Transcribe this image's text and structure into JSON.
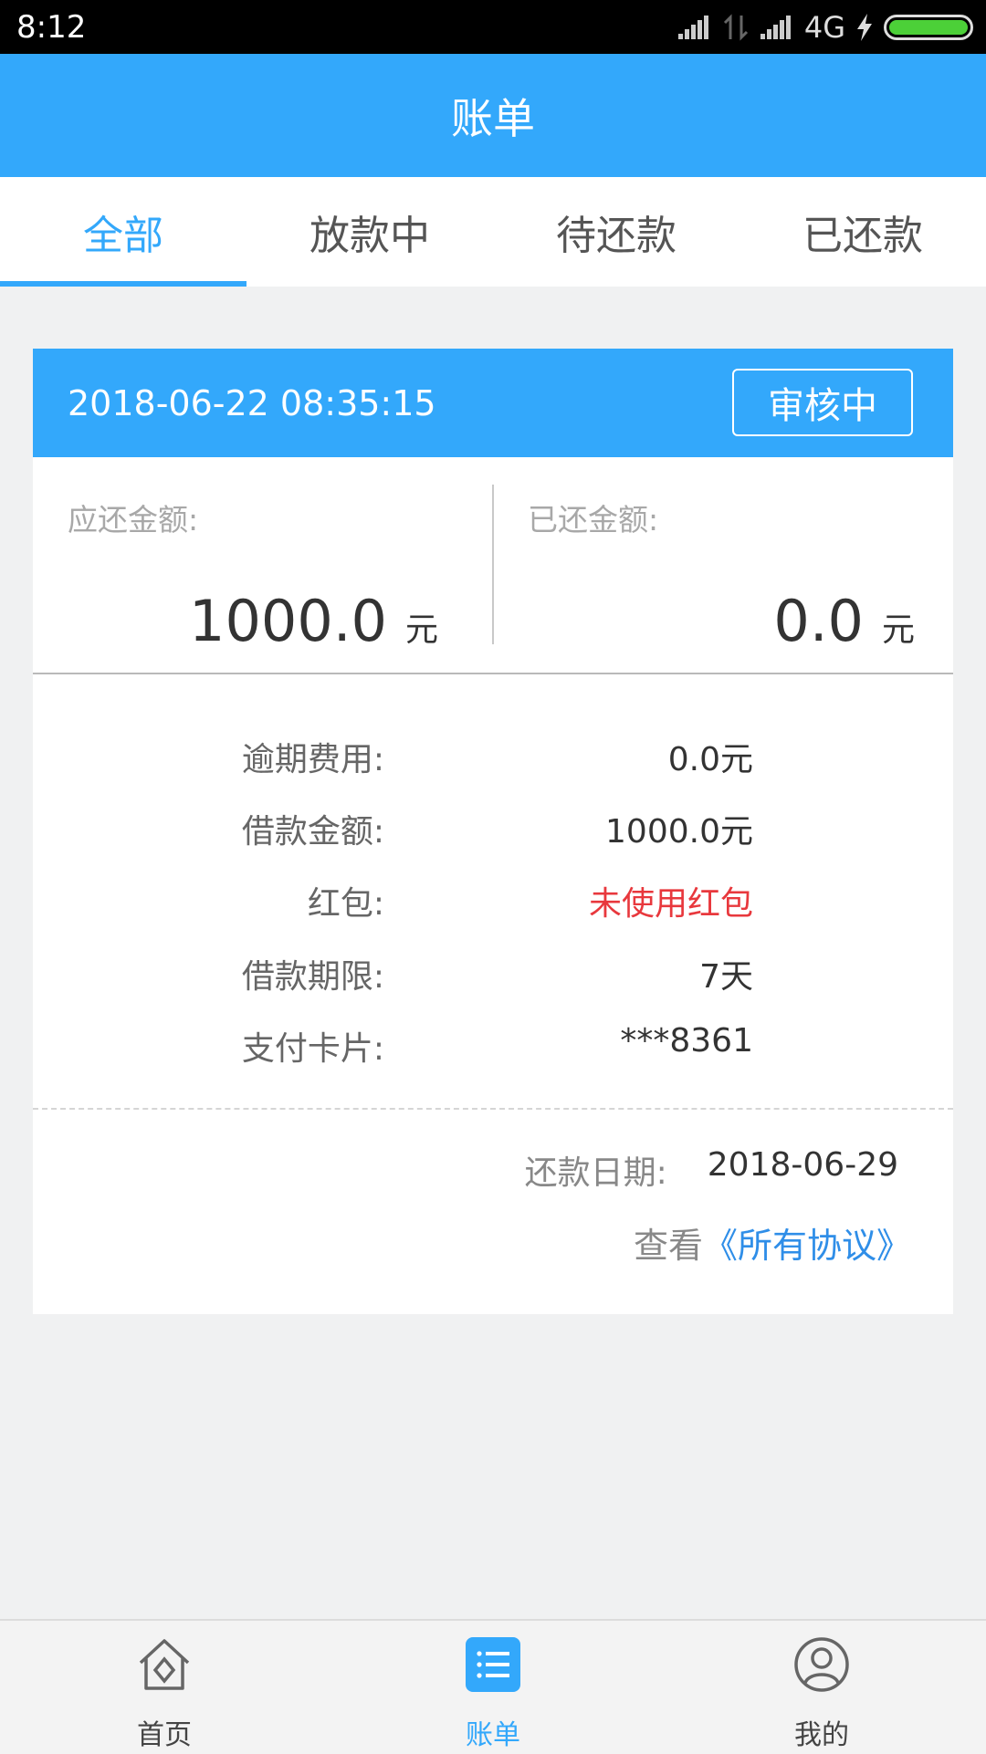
{
  "status_bar": {
    "time": "8:12",
    "network": "4G",
    "icons": [
      "signal-icon",
      "data-transfer-icon",
      "signal-icon",
      "charging-icon",
      "battery-icon"
    ]
  },
  "header": {
    "title": "账单"
  },
  "tabs": [
    {
      "label": "全部",
      "active": true
    },
    {
      "label": "放款中",
      "active": false
    },
    {
      "label": "待还款",
      "active": false
    },
    {
      "label": "已还款",
      "active": false
    }
  ],
  "bill": {
    "datetime": "2018-06-22 08:35:15",
    "status": "审核中",
    "due_amount": {
      "label": "应还金额:",
      "value": "1000.0",
      "unit": "元"
    },
    "paid_amount": {
      "label": "已还金额:",
      "value": "0.0",
      "unit": "元"
    },
    "details": [
      {
        "label": "逾期费用:",
        "value": "0.0元"
      },
      {
        "label": "借款金额:",
        "value": "1000.0元"
      },
      {
        "label": "红包:",
        "value": "未使用红包"
      },
      {
        "label": "借款期限:",
        "value": "7天"
      },
      {
        "label": "支付卡片:",
        "value": "***8361"
      }
    ],
    "repay_date": {
      "label": "还款日期:",
      "value": "2018-06-29"
    },
    "agreement": {
      "prefix": "查看",
      "link": "《所有协议》"
    }
  },
  "bottom_nav": [
    {
      "label": "首页",
      "icon": "home-icon",
      "active": false
    },
    {
      "label": "账单",
      "icon": "bill-list-icon",
      "active": true
    },
    {
      "label": "我的",
      "icon": "profile-icon",
      "active": false
    }
  ],
  "colors": {
    "primary": "#33a8fb",
    "link": "#2f8ee8",
    "warning": "#e8383d",
    "background": "#f0f1f2"
  }
}
